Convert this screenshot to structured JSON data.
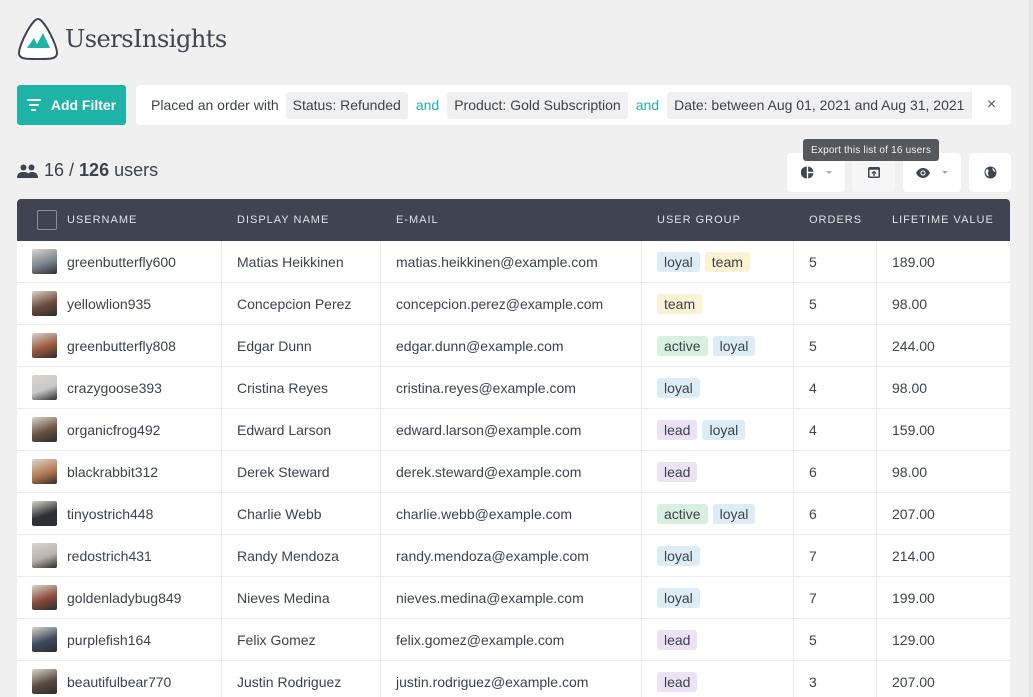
{
  "app": {
    "brand": "UsersInsights",
    "accent_color": "#1fb2a6"
  },
  "toolbar": {
    "add_filter_label": "Add Filter",
    "filter": {
      "lead": "Placed an order with",
      "chips": [
        "Status: Refunded",
        "Product: Gold Subscription",
        "Date: between Aug 01, 2021 and Aug 31, 2021"
      ],
      "conjunction": "and",
      "close_icon": "×"
    }
  },
  "summary": {
    "filtered": "16",
    "separator": "/",
    "total": "126",
    "unit": "users"
  },
  "actions": {
    "tooltip": "Export this list of 16 users",
    "buttons": [
      {
        "icon": "segments-pie-icon",
        "has_dropdown": true
      },
      {
        "icon": "export-icon",
        "has_dropdown": false
      },
      {
        "icon": "eye-icon",
        "has_dropdown": true
      },
      {
        "icon": "globe-icon",
        "has_dropdown": false
      }
    ]
  },
  "table": {
    "columns": [
      "USERNAME",
      "DISPLAY NAME",
      "E-MAIL",
      "USER GROUP",
      "ORDERS",
      "LIFETIME VALUE"
    ],
    "tag_colors": {
      "loyal": "#dcedf8",
      "team": "#fdf1d4",
      "active": "#d7f0e1",
      "lead": "#ebe2f8"
    },
    "rows": [
      {
        "username": "greenbutterfly600",
        "display": "Matias Heikkinen",
        "email": "matias.heikkinen@example.com",
        "groups": [
          "loyal",
          "team"
        ],
        "orders": "5",
        "ltv": "189.00",
        "avatar_color": "#7a8590"
      },
      {
        "username": "yellowlion935",
        "display": "Concepcion Perez",
        "email": "concepcion.perez@example.com",
        "groups": [
          "team"
        ],
        "orders": "5",
        "ltv": "98.00",
        "avatar_color": "#6b4a3a"
      },
      {
        "username": "greenbutterfly808",
        "display": "Edgar Dunn",
        "email": "edgar.dunn@example.com",
        "groups": [
          "active",
          "loyal"
        ],
        "orders": "5",
        "ltv": "244.00",
        "avatar_color": "#9a5a3e"
      },
      {
        "username": "crazygoose393",
        "display": "Cristina Reyes",
        "email": "cristina.reyes@example.com",
        "groups": [
          "loyal"
        ],
        "orders": "4",
        "ltv": "98.00",
        "avatar_color": "#c9c9c9"
      },
      {
        "username": "organicfrog492",
        "display": "Edward Larson",
        "email": "edward.larson@example.com",
        "groups": [
          "lead",
          "loyal"
        ],
        "orders": "4",
        "ltv": "159.00",
        "avatar_color": "#6a5440"
      },
      {
        "username": "blackrabbit312",
        "display": "Derek Steward",
        "email": "derek.steward@example.com",
        "groups": [
          "lead"
        ],
        "orders": "6",
        "ltv": "98.00",
        "avatar_color": "#b67a52"
      },
      {
        "username": "tinyostrich448",
        "display": "Charlie Webb",
        "email": "charlie.webb@example.com",
        "groups": [
          "active",
          "loyal"
        ],
        "orders": "6",
        "ltv": "207.00",
        "avatar_color": "#2e3236"
      },
      {
        "username": "redostrich431",
        "display": "Randy Mendoza",
        "email": "randy.mendoza@example.com",
        "groups": [
          "loyal"
        ],
        "orders": "7",
        "ltv": "214.00",
        "avatar_color": "#b8b2aa"
      },
      {
        "username": "goldenladybug849",
        "display": "Nieves Medina",
        "email": "nieves.medina@example.com",
        "groups": [
          "loyal"
        ],
        "orders": "7",
        "ltv": "199.00",
        "avatar_color": "#8a4a3a"
      },
      {
        "username": "purplefish164",
        "display": "Felix Gomez",
        "email": "felix.gomez@example.com",
        "groups": [
          "lead"
        ],
        "orders": "5",
        "ltv": "129.00",
        "avatar_color": "#3e4a60"
      },
      {
        "username": "beautifulbear770",
        "display": "Justin Rodriguez",
        "email": "justin.rodriguez@example.com",
        "groups": [
          "lead"
        ],
        "orders": "3",
        "ltv": "207.00",
        "avatar_color": "#5a4a40"
      }
    ]
  }
}
